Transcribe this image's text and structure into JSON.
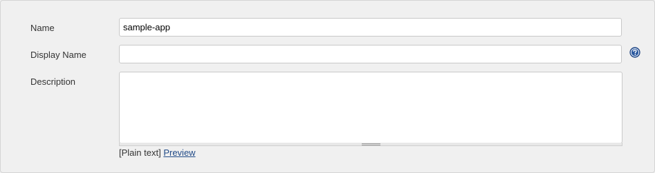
{
  "form": {
    "name": {
      "label": "Name",
      "value": "sample-app"
    },
    "display_name": {
      "label": "Display Name",
      "value": ""
    },
    "description": {
      "label": "Description",
      "value": "",
      "markup_prefix": "[Plain text]",
      "preview_label": "Preview"
    }
  },
  "icons": {
    "help": "help-icon"
  },
  "colors": {
    "background": "#f0f0f0",
    "link": "#204a87",
    "help_icon": "#2c5aa0"
  }
}
